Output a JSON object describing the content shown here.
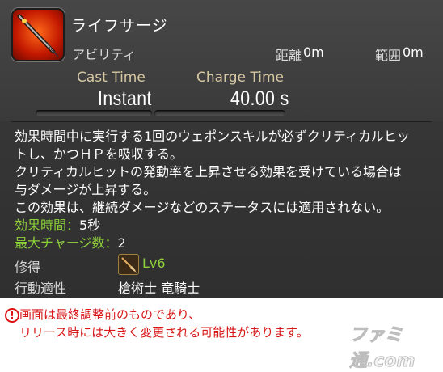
{
  "ability": {
    "name": "ライフサージ",
    "type": "アビリティ",
    "range_label": "距離",
    "range_value": "0m",
    "radius_label": "範囲",
    "radius_value": "0m",
    "cast_label": "Cast Time",
    "cast_value": "Instant",
    "charge_label": "Charge Time",
    "charge_value": "40.00 s"
  },
  "description": {
    "lines": [
      "効果時間中に実行する1回のウェポンスキルが必ずクリティカルヒッ",
      "トし、かつＨＰを吸収する。",
      "クリティカルヒットの発動率を上昇させる効果を受けている場合は",
      "与ダメージが上昇する。",
      "この効果は、継続ダメージなどのステータスには適用されない。"
    ],
    "duration_label": "効果時間：",
    "duration_value": "5秒",
    "charges_label": "最大チャージ数：",
    "charges_value": "2"
  },
  "meta": {
    "acquired_label": "修得",
    "acquired_level": "Lv6",
    "job_icon": "lancer-spear-icon",
    "jobs_label": "行動適性",
    "jobs_value": "槍術士 竜騎士"
  },
  "notice": {
    "icon": "warning-circle-icon",
    "line1": "画面は最終調整前のものであり、",
    "line2": "リリース時には大きく変更される可能性があります。",
    "logo": "ファミ通.com"
  },
  "colors": {
    "panel": "#3a3a3a",
    "label_gold": "#d7c8a2",
    "green": "#8fd13a",
    "notice_red": "#d81818"
  }
}
